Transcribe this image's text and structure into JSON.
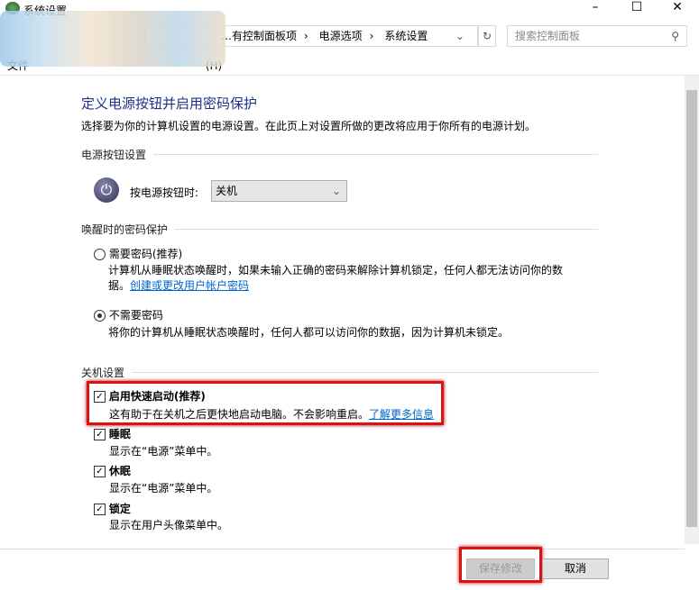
{
  "window": {
    "title": "系统设置",
    "minimize": "–",
    "maximize": "☐",
    "close": "✕"
  },
  "address": {
    "breadcrumb": [
      "…有控制面板项",
      "电源选项",
      "系统设置"
    ],
    "sep": "›",
    "dropdown": "⌄",
    "refresh": "↻"
  },
  "search": {
    "placeholder": "搜索控制面板",
    "icon": "⚲"
  },
  "menu": {
    "visible_items": [
      "文件",
      "(H)"
    ]
  },
  "page": {
    "title": "定义电源按钮并启用密码保护",
    "description": "选择要为你的计算机设置的电源设置。在此页上对设置所做的更改将应用于你所有的电源计划。",
    "power_section": {
      "heading": "电源按钮设置",
      "label": "按电源按钮时:",
      "value": "关机"
    },
    "password_section": {
      "heading": "唤醒时的密码保护",
      "options": [
        {
          "label": "需要密码(推荐)",
          "desc": "计算机从睡眠状态唤醒时，如果未输入正确的密码来解除计算机锁定，任何人都无法访问你的数",
          "desc2": "据。",
          "link": "创建或更改用户帐户密码",
          "selected": false
        },
        {
          "label": "不需要密码",
          "desc": "将你的计算机从睡眠状态唤醒时，任何人都可以访问你的数据，因为计算机未锁定。",
          "selected": true
        }
      ]
    },
    "shutdown_section": {
      "heading": "关机设置",
      "items": [
        {
          "label": "启用快速启动(推荐)",
          "desc": "这有助于在关机之后更快地启动电脑。不会影响重启。",
          "link": "了解更多信息",
          "checked": true
        },
        {
          "label": "睡眠",
          "desc": "显示在“电源”菜单中。",
          "checked": true
        },
        {
          "label": "休眠",
          "desc": "显示在“电源”菜单中。",
          "checked": true
        },
        {
          "label": "锁定",
          "desc": "显示在用户头像菜单中。",
          "checked": true
        }
      ]
    }
  },
  "buttons": {
    "save": "保存修改",
    "cancel": "取消"
  },
  "highlight_color": "#dd1111"
}
